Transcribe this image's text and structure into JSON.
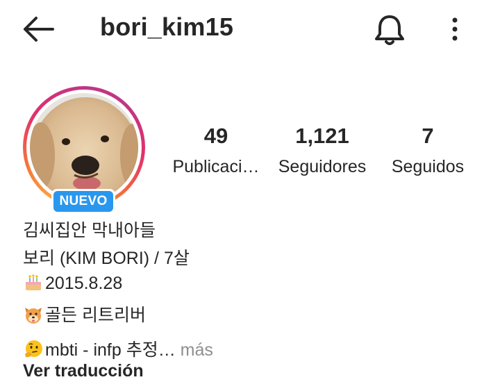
{
  "header": {
    "username": "bori_kim15",
    "back_icon": "arrow-left-icon",
    "bell_icon": "bell-icon",
    "more_icon": "more-vertical-icon"
  },
  "profile": {
    "avatar_description": "golden retriever",
    "badge": "NUEVO",
    "story_ring_colors": [
      "#fdb144",
      "#f77737",
      "#e1306c",
      "#c13584"
    ]
  },
  "stats": [
    {
      "value": "49",
      "label": "Publicaci…"
    },
    {
      "value": "1,121",
      "label": "Seguidores"
    },
    {
      "value": "7",
      "label": "Seguidos"
    }
  ],
  "bio": {
    "line1": "김씨집안 막내아들",
    "line2": "보리 (KIM BORI) / 7살",
    "line3": "2015.8.28",
    "line4": "골든 리트리버",
    "line5": "mbti - infp 추정…",
    "more": "más",
    "translate": "Ver traducción",
    "emoji_icons": [
      "birthday-cake-icon",
      "dog-face-icon",
      "thinking-face-icon"
    ]
  },
  "colors": {
    "text": "#262626",
    "secondary": "#8e8e8e",
    "badge": "#2a97ee"
  }
}
